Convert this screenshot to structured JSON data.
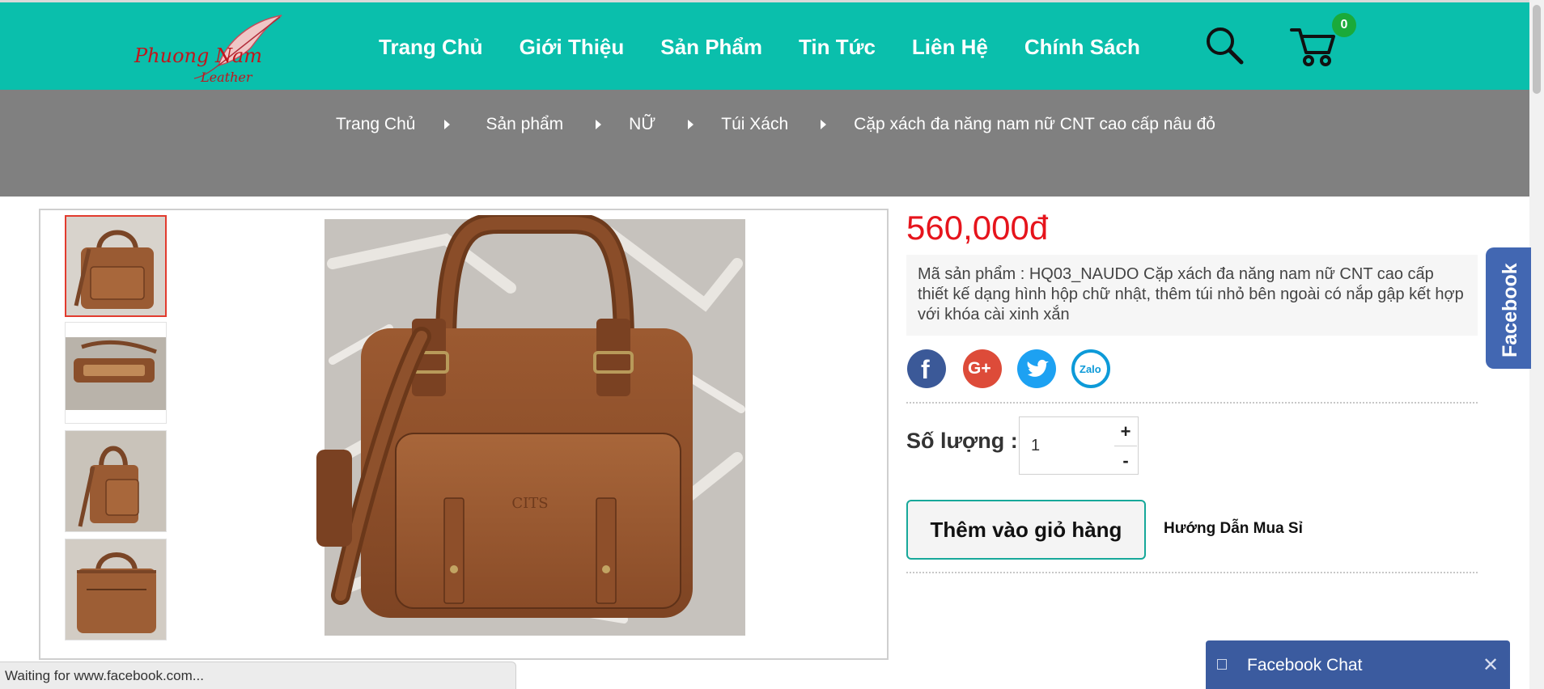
{
  "header": {
    "logo": {
      "line1": "Phuong Nam",
      "line2": "Leather"
    },
    "nav": [
      "Trang Chủ",
      "Giới Thiệu",
      "Sản Phẩm",
      "Tin Tức",
      "Liên Hệ",
      "Chính Sách"
    ],
    "cart_count": "0",
    "icons": {
      "search": "search-icon",
      "cart": "cart-icon"
    },
    "colors": {
      "bar": "#0abfac",
      "badge": "#1aaa3a"
    }
  },
  "breadcrumb": [
    "Trang Chủ",
    "Sản phẩm",
    "NỮ",
    "Túi Xách",
    "Cặp xách đa năng nam nữ CNT cao cấp nâu đỏ"
  ],
  "product": {
    "price": "560,000đ",
    "description": "Mã sản phẩm : HQ03_NAUDO Cặp xách đa năng nam nữ CNT cao cấp thiết kế dạng hình hộp chữ nhật, thêm túi nhỏ bên ngoài có nắp gập kết hợp với khóa cài xinh xắn",
    "share": [
      {
        "name": "facebook",
        "icon": "facebook-share-icon",
        "label": "f",
        "color": "#3b5998"
      },
      {
        "name": "google-plus",
        "icon": "google-plus-share-icon",
        "label": "G+",
        "color": "#dd4b39"
      },
      {
        "name": "twitter",
        "icon": "twitter-share-icon",
        "label": "",
        "color": "#1da1f2"
      },
      {
        "name": "zalo",
        "icon": "zalo-share-icon",
        "label": "Zalo",
        "color": "#0d9ad8"
      }
    ],
    "qty_label": "Số lượng :",
    "qty_value": "1",
    "qty_plus": "+",
    "qty_minus": "-",
    "add_to_cart": "Thêm vào giỏ hàng",
    "guide": "Hướng Dẫn Mua Sỉ",
    "brand_mark": "CITS",
    "thumb_count": 4,
    "active_thumb": 1
  },
  "side_tab": {
    "label": "Facebook",
    "color": "#4267b2"
  },
  "fb_chat": {
    "label": "Facebook Chat",
    "close": "✕",
    "color": "#3b5b9f"
  },
  "status_bar": "Waiting for www.facebook.com..."
}
